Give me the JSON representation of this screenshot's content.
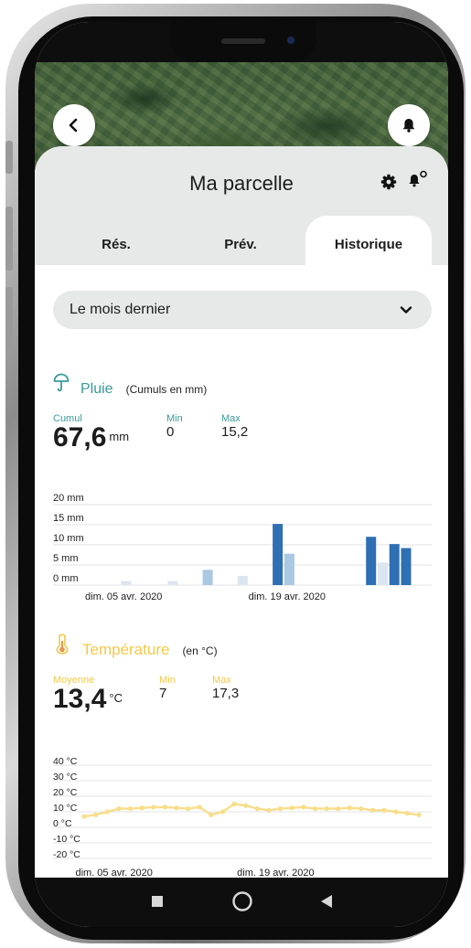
{
  "header": {
    "title": "Ma parcelle"
  },
  "icons": {
    "back": "chevron-left-icon",
    "bell": "bell-icon",
    "settings": "gear-icon",
    "bell_settings": "bell-gear-icon",
    "dropdown": "chevron-down-icon",
    "rain": "umbrella-icon",
    "temperature": "thermometer-icon"
  },
  "tabs": [
    {
      "label": "Rés.",
      "active": false
    },
    {
      "label": "Prév.",
      "active": false
    },
    {
      "label": "Historique",
      "active": true
    }
  ],
  "period_select": {
    "value": "Le mois dernier"
  },
  "rain": {
    "title": "Pluie",
    "unit_note": "(Cumuls en mm)",
    "cumul_label": "Cumul",
    "cumul_value": "67,6",
    "cumul_unit": "mm",
    "min_label": "Min",
    "min_value": "0",
    "max_label": "Max",
    "max_value": "15,2"
  },
  "temperature": {
    "title": "Température",
    "unit_note": "(en °C)",
    "avg_label": "Moyenne",
    "avg_value": "13,4",
    "avg_unit": "°C",
    "min_label": "Min",
    "min_value": "7",
    "max_label": "Max",
    "max_value": "17,3"
  },
  "colors": {
    "rain_accent": "#3a9a9a",
    "temp_accent": "#f2c94c",
    "bar_dark": "#2f6fb3",
    "bar_light": "#a9c8e4",
    "bar_pale": "#dbe6f1",
    "temp_line": "#f7de8a"
  },
  "chart_data": [
    {
      "type": "bar",
      "title": "Pluie",
      "ylabel": "",
      "ylim": [
        0,
        20
      ],
      "y_ticks": [
        "20 mm",
        "15 mm",
        "10 mm",
        "5 mm",
        "0 mm"
      ],
      "y_tick_values": [
        20,
        15,
        10,
        5,
        0
      ],
      "x_labels": [
        "dim. 05 avr. 2020",
        "dim. 19 avr. 2020"
      ],
      "x_label_days": [
        5,
        19
      ],
      "x_range_days": [
        1,
        30
      ],
      "bars": [
        {
          "day": 4,
          "value": 1.0,
          "shade": "pale"
        },
        {
          "day": 8,
          "value": 1.0,
          "shade": "pale"
        },
        {
          "day": 11,
          "value": 3.8,
          "shade": "light"
        },
        {
          "day": 14,
          "value": 2.3,
          "shade": "pale"
        },
        {
          "day": 17,
          "value": 15.2,
          "shade": "dark"
        },
        {
          "day": 18,
          "value": 7.8,
          "shade": "light"
        },
        {
          "day": 25,
          "value": 12.0,
          "shade": "dark"
        },
        {
          "day": 26,
          "value": 5.6,
          "shade": "pale"
        },
        {
          "day": 27,
          "value": 10.2,
          "shade": "dark"
        },
        {
          "day": 28,
          "value": 9.2,
          "shade": "dark"
        }
      ]
    },
    {
      "type": "line",
      "title": "Température",
      "ylabel": "",
      "ylim": [
        -20,
        40
      ],
      "y_ticks": [
        "40 °C",
        "30 °C",
        "20 °C",
        "10 °C",
        "0 °C",
        "-10 °C",
        "-20 °C"
      ],
      "y_tick_values": [
        40,
        30,
        20,
        10,
        0,
        -10,
        -20
      ],
      "x_labels": [
        "dim. 05 avr. 2020",
        "dim. 19 avr. 2020"
      ],
      "x_label_days": [
        5,
        19
      ],
      "x_range_days": [
        1,
        30
      ],
      "x": [
        1,
        2,
        3,
        4,
        5,
        6,
        7,
        8,
        9,
        10,
        11,
        12,
        13,
        14,
        15,
        16,
        17,
        18,
        19,
        20,
        21,
        22,
        23,
        24,
        25,
        26,
        27,
        28,
        29,
        30
      ],
      "values": [
        7,
        8,
        10,
        12,
        12,
        12.5,
        13,
        13,
        12.5,
        12,
        13,
        8,
        10,
        15,
        14,
        12,
        11,
        12,
        12.5,
        13,
        12,
        12,
        12,
        12.5,
        12,
        11,
        11,
        10,
        9,
        8
      ]
    }
  ]
}
